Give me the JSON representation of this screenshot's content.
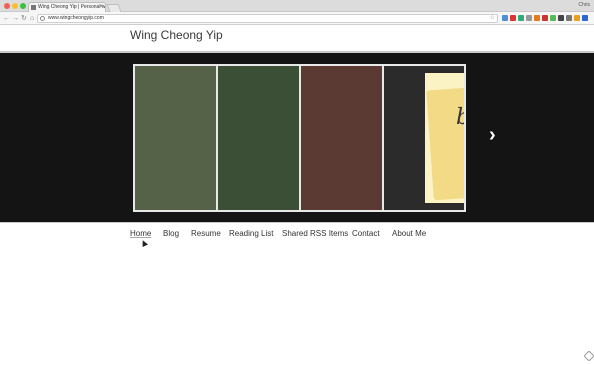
{
  "browser": {
    "tab_title": "Wing Cheong Yip | Personal w",
    "tab_close": "×",
    "url": "www.wingcheongyip.com",
    "user_label": "Chris",
    "back": "←",
    "forward": "→",
    "reload": "↻",
    "home": "⌂",
    "star": "☆"
  },
  "site": {
    "title": "Wing Cheong Yip"
  },
  "slider": {
    "next_label": "›",
    "slides": [
      {
        "color": "#566247"
      },
      {
        "color": "#3a4f36"
      },
      {
        "color": "#5a3a33"
      },
      {
        "color": "#2b2b2b"
      }
    ],
    "note_text": "b"
  },
  "nav": {
    "items": [
      {
        "label": "Home"
      },
      {
        "label": "Blog"
      },
      {
        "label": "Resume"
      },
      {
        "label": "Reading List"
      },
      {
        "label": "Shared RSS Items"
      },
      {
        "label": "Contact"
      },
      {
        "label": "About Me"
      }
    ]
  },
  "icons": {
    "extensions": [
      "#4a90d9",
      "#d33",
      "#3a7",
      "#999",
      "#e87a1a",
      "#c33",
      "#5b5",
      "#444",
      "#777",
      "#e9a020",
      "#2a6ad0"
    ]
  }
}
